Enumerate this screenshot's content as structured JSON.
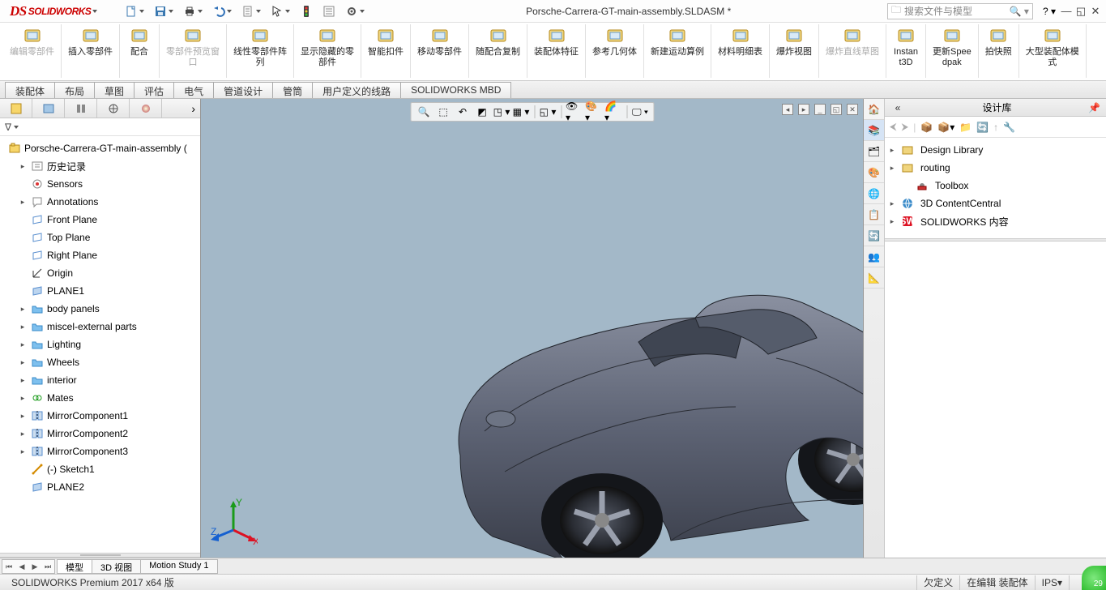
{
  "app": {
    "logo": "SOLIDWORKS",
    "title": "Porsche-Carrera-GT-main-assembly.SLDASM *"
  },
  "qat": {
    "file_dd": "file-dd",
    "save_dd": "save-dd",
    "print_dd": "print-dd",
    "undo_dd": "undo-dd",
    "redo_dd": "redo-dd",
    "select_dd": "select-dd",
    "rebuild": "rebuild",
    "options": "options",
    "options_dd": "options-dd"
  },
  "search": {
    "placeholder": "搜索文件与模型"
  },
  "ribbon": [
    {
      "id": "edit-part",
      "label": "编辑零部件",
      "disabled": true
    },
    {
      "id": "insert-part",
      "label": "插入零部件"
    },
    {
      "id": "mate",
      "label": "配合"
    },
    {
      "id": "preview",
      "label": "零部件预览窗口",
      "disabled": true
    },
    {
      "id": "linear-pat",
      "label": "线性零部件阵列"
    },
    {
      "id": "showhide",
      "label": "显示隐藏的零部件"
    },
    {
      "id": "smart-fast",
      "label": "智能扣件"
    },
    {
      "id": "move-part",
      "label": "移动零部件"
    },
    {
      "id": "rand-mate",
      "label": "随配合复制"
    },
    {
      "id": "assy-feat",
      "label": "装配体特征"
    },
    {
      "id": "ref-geom",
      "label": "参考几何体"
    },
    {
      "id": "motion",
      "label": "新建运动算例"
    },
    {
      "id": "bom",
      "label": "材料明细表"
    },
    {
      "id": "exploded",
      "label": "爆炸视图"
    },
    {
      "id": "exp-sketch",
      "label": "爆炸直线草图",
      "disabled": true
    },
    {
      "id": "instant3d",
      "label": "Instant3D"
    },
    {
      "id": "speedpak",
      "label": "更新Speedpak"
    },
    {
      "id": "snapshot",
      "label": "拍快照"
    },
    {
      "id": "large-assy",
      "label": "大型装配体模式"
    }
  ],
  "doctabs": [
    "装配体",
    "布局",
    "草图",
    "评估",
    "电气",
    "管道设计",
    "管筒",
    "用户定义的线路",
    "SOLIDWORKS MBD"
  ],
  "tree": {
    "root": "Porsche-Carrera-GT-main-assembly  (",
    "items": [
      {
        "exp": "▸",
        "icon": "history",
        "label": "历史记录",
        "ind": 1
      },
      {
        "exp": "",
        "icon": "sensor",
        "label": "Sensors",
        "ind": 1
      },
      {
        "exp": "▸",
        "icon": "annot",
        "label": "Annotations",
        "ind": 1
      },
      {
        "exp": "",
        "icon": "plane",
        "label": "Front Plane",
        "ind": 1
      },
      {
        "exp": "",
        "icon": "plane",
        "label": "Top Plane",
        "ind": 1
      },
      {
        "exp": "",
        "icon": "plane",
        "label": "Right Plane",
        "ind": 1
      },
      {
        "exp": "",
        "icon": "origin",
        "label": "Origin",
        "ind": 1
      },
      {
        "exp": "",
        "icon": "plane2",
        "label": "PLANE1",
        "ind": 1
      },
      {
        "exp": "▸",
        "icon": "folder",
        "label": "body panels",
        "ind": 1
      },
      {
        "exp": "▸",
        "icon": "folder",
        "label": "miscel-external parts",
        "ind": 1
      },
      {
        "exp": "▸",
        "icon": "folder",
        "label": "Lighting",
        "ind": 1
      },
      {
        "exp": "▸",
        "icon": "folder",
        "label": "Wheels",
        "ind": 1
      },
      {
        "exp": "▸",
        "icon": "folder",
        "label": "interior",
        "ind": 1
      },
      {
        "exp": "▸",
        "icon": "mates",
        "label": "Mates",
        "ind": 1
      },
      {
        "exp": "▸",
        "icon": "mirror",
        "label": "MirrorComponent1",
        "ind": 1
      },
      {
        "exp": "▸",
        "icon": "mirror",
        "label": "MirrorComponent2",
        "ind": 1
      },
      {
        "exp": "▸",
        "icon": "mirror",
        "label": "MirrorComponent3",
        "ind": 1
      },
      {
        "exp": "",
        "icon": "sketch",
        "label": "(-) Sketch1",
        "ind": 1
      },
      {
        "exp": "",
        "icon": "plane2",
        "label": "PLANE2",
        "ind": 1
      }
    ]
  },
  "bottom_tabs": {
    "model": "模型",
    "view3d": "3D 视图",
    "motion": "Motion Study 1"
  },
  "taskpane": {
    "title": "设计库",
    "items": [
      {
        "exp": "▸",
        "icon": "lib-root",
        "label": "Design Library"
      },
      {
        "exp": "▸",
        "icon": "lib-root",
        "label": "routing"
      },
      {
        "exp": "",
        "icon": "toolbox",
        "label": "Toolbox",
        "indent": true
      },
      {
        "exp": "▸",
        "icon": "cc",
        "label": "3D ContentCentral"
      },
      {
        "exp": "▸",
        "icon": "sw",
        "label": "SOLIDWORKS 内容"
      }
    ]
  },
  "status": {
    "app": "SOLIDWORKS Premium 2017 x64 版",
    "under": "欠定义",
    "editing": "在编辑 装配体",
    "units": "IPS",
    "badge": "29"
  }
}
